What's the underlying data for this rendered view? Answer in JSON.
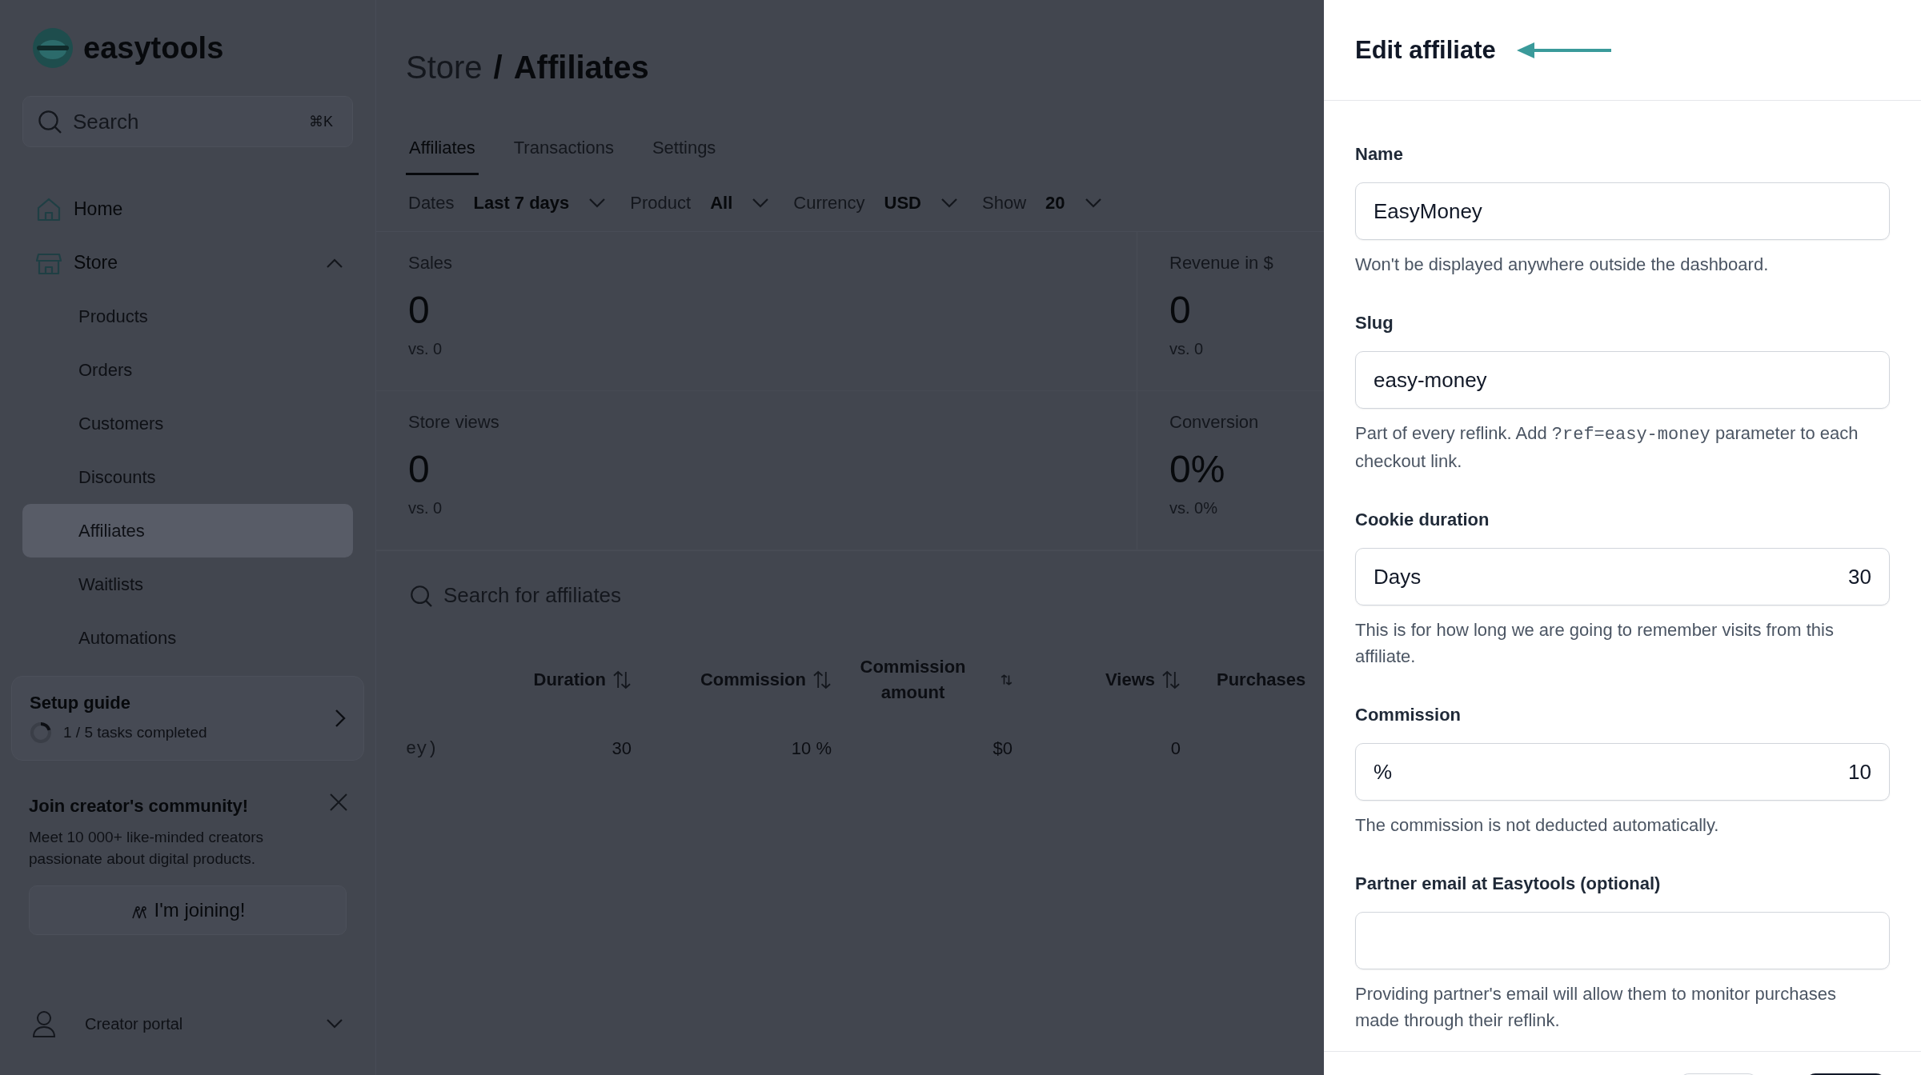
{
  "logo": {
    "text": "easytools"
  },
  "sidebar": {
    "search": {
      "placeholder": "Search",
      "shortcut": "⌘K"
    },
    "items": [
      {
        "label": "Home",
        "selected": false
      },
      {
        "label": "Store",
        "selected": false,
        "expanded": true,
        "children": [
          {
            "label": "Products",
            "selected": false
          },
          {
            "label": "Orders",
            "selected": false
          },
          {
            "label": "Customers",
            "selected": false
          },
          {
            "label": "Discounts",
            "selected": false
          },
          {
            "label": "Affiliates",
            "selected": true
          },
          {
            "label": "Waitlists",
            "selected": false
          },
          {
            "label": "Automations",
            "selected": false
          }
        ]
      }
    ],
    "setup_guide": {
      "title": "Setup guide",
      "progress": "1 / 5 tasks completed",
      "level": 0.2
    },
    "community": {
      "title": "Join creator's community!",
      "text": "Meet 10 000+ like-minded creators passionate about digital products.",
      "button": "I'm joining!"
    },
    "account": {
      "label": "Creator portal",
      "expanded": false
    }
  },
  "main": {
    "breadcrumb": {
      "parent": "Store",
      "separator": "/",
      "current": "Affiliates"
    },
    "tabs": [
      {
        "label": "Affiliates",
        "selected": true
      },
      {
        "label": "Transactions",
        "selected": false
      },
      {
        "label": "Settings",
        "selected": false
      }
    ],
    "filters": [
      {
        "label": "Dates",
        "value": "Last 7 days"
      },
      {
        "label": "Product",
        "value": "All"
      },
      {
        "label": "Currency",
        "value": "USD"
      },
      {
        "label": "Show",
        "value": "20"
      }
    ],
    "stats": [
      {
        "label": "Sales",
        "value": "0",
        "comparison": "vs. 0"
      },
      {
        "label": "Revenue in $",
        "value": "0",
        "comparison": "vs. 0"
      },
      {
        "label": "Store views",
        "value": "0",
        "comparison": "vs. 0"
      },
      {
        "label": "Conversion",
        "value": "0%",
        "comparison": "vs. 0%"
      }
    ],
    "search": {
      "placeholder": "Search for affiliates"
    },
    "table": {
      "columns": [
        {
          "label": "Duration",
          "sortable": true
        },
        {
          "label": "Commission",
          "sortable": true
        },
        {
          "label": "Commission amount",
          "sortable": true
        },
        {
          "label": "Views",
          "sortable": true
        },
        {
          "label": "Purchases",
          "sortable": false
        }
      ],
      "rows": [
        {
          "column_1": "ey)",
          "cells": [
            "30",
            "10 %",
            "$0",
            "0"
          ]
        }
      ]
    }
  },
  "drawer": {
    "title": "Edit affiliate",
    "fields": [
      {
        "label": "Name",
        "value": "EasyMoney",
        "help": [
          {
            "kind": "text",
            "text": "Won't be displayed anywhere outside the dashboard."
          }
        ]
      },
      {
        "label": "Slug",
        "value": "easy-money",
        "help": [
          {
            "kind": "text",
            "text": "Part of every reflink. Add "
          },
          {
            "kind": "code",
            "text": "?ref=easy-money"
          },
          {
            "kind": "text",
            "text": " parameter to each checkout link."
          }
        ]
      },
      {
        "label": "Cookie duration",
        "prefix": "Days",
        "value": "30",
        "help": [
          {
            "kind": "text",
            "text": "This is for how long we are going to remember visits from this affiliate."
          }
        ]
      },
      {
        "label": "Commission",
        "prefix": "%",
        "value": "10",
        "help": [
          {
            "kind": "text",
            "text": "The commission is not deducted automatically."
          }
        ]
      },
      {
        "label": "Partner email at Easytools (optional)",
        "help": [
          {
            "kind": "text",
            "text": "Providing partner's email will allow them to monitor purchases made through their reflink."
          }
        ]
      }
    ]
  }
}
